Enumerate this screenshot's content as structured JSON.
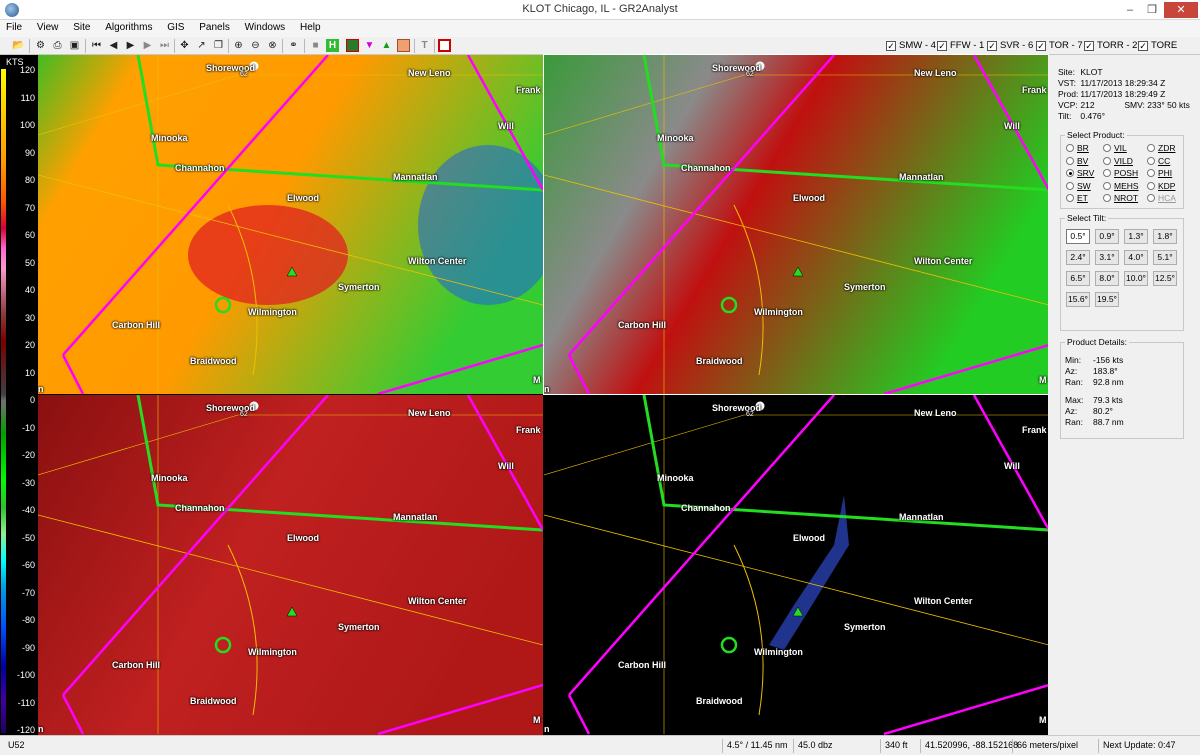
{
  "window": {
    "title": "KLOT Chicago, IL - GR2Analyst",
    "minimize": "–",
    "restore": "❒",
    "close": "✕"
  },
  "menu": [
    "File",
    "View",
    "Site",
    "Algorithms",
    "GIS",
    "Panels",
    "Windows",
    "Help"
  ],
  "warnings": [
    {
      "label": "SMW - 4",
      "checked": true
    },
    {
      "label": "FFW - 1",
      "checked": true
    },
    {
      "label": "SVR - 6",
      "checked": true
    },
    {
      "label": "TOR - 7",
      "checked": true
    },
    {
      "label": "TORR - 2",
      "checked": true
    },
    {
      "label": "TORE",
      "checked": true
    }
  ],
  "legend": {
    "units": "KTS",
    "ticks": [
      "120",
      "110",
      "100",
      "90",
      "80",
      "70",
      "60",
      "50",
      "40",
      "30",
      "20",
      "10",
      "0",
      "-10",
      "-20",
      "-30",
      "-40",
      "-50",
      "-60",
      "-70",
      "-80",
      "-90",
      "-100",
      "-110",
      "-120"
    ]
  },
  "towns": {
    "shorewood": "Shorewood",
    "new_lenox": "New Leno",
    "frankfort": "Frank",
    "will": "Will",
    "minooka": "Minooka",
    "channahon": "Channahon",
    "manhattan": "Mannatlan",
    "elwood": "Elwood",
    "wilton_center": "Wilton Center",
    "symerton": "Symerton",
    "wilmington": "Wilmington",
    "carbon_hill": "Carbon Hill",
    "braidwood": "Braidwood",
    "route": "62",
    "edge_n": "n",
    "edge_m": "M"
  },
  "site_info": {
    "site_label": "Site:",
    "site": "KLOT",
    "vst_label": "VST:",
    "vst": "11/17/2013  18:29:34 Z",
    "prod_label": "Prod:",
    "prod": "11/17/2013  18:29:49 Z",
    "vcp_label": "VCP:",
    "vcp": "212",
    "smv_label": "SMV:",
    "smv": "233° 50 kts",
    "tilt_label": "Tilt:",
    "tilt": "0.476°"
  },
  "select_product": {
    "title": "Select Product:",
    "options": [
      {
        "label": "BR",
        "selected": false,
        "disabled": false
      },
      {
        "label": "VIL",
        "selected": false,
        "disabled": false
      },
      {
        "label": "ZDR",
        "selected": false,
        "disabled": false
      },
      {
        "label": "BV",
        "selected": false,
        "disabled": false
      },
      {
        "label": "VILD",
        "selected": false,
        "disabled": false
      },
      {
        "label": "CC",
        "selected": false,
        "disabled": false
      },
      {
        "label": "SRV",
        "selected": true,
        "disabled": false
      },
      {
        "label": "POSH",
        "selected": false,
        "disabled": false
      },
      {
        "label": "PHI",
        "selected": false,
        "disabled": false
      },
      {
        "label": "SW",
        "selected": false,
        "disabled": false
      },
      {
        "label": "MEHS",
        "selected": false,
        "disabled": false
      },
      {
        "label": "KDP",
        "selected": false,
        "disabled": false
      },
      {
        "label": "ET",
        "selected": false,
        "disabled": false
      },
      {
        "label": "NROT",
        "selected": false,
        "disabled": false
      },
      {
        "label": "HCA",
        "selected": false,
        "disabled": true
      }
    ]
  },
  "select_tilt": {
    "title": "Select Tilt:",
    "tilts": [
      "0.5°",
      "0.9°",
      "1.3°",
      "1.8°",
      "2.4°",
      "3.1°",
      "4.0°",
      "5.1°",
      "6.5°",
      "8.0°",
      "10.0°",
      "12.5°",
      "15.6°",
      "19.5°"
    ],
    "selected": "0.5°"
  },
  "product_details": {
    "title": "Product Details:",
    "min_label": "Min:",
    "min": "-156 kts",
    "min_az_label": "Az:",
    "min_az": "183.8°",
    "min_ran_label": "Ran:",
    "min_ran": "92.8 nm",
    "max_label": "Max:",
    "max": "79.3 kts",
    "max_az_label": "Az:",
    "max_az": "80.2°",
    "max_ran_label": "Ran:",
    "max_ran": "88.7 nm"
  },
  "status": {
    "id": "U52",
    "beam": "4.5° / 11.45 nm",
    "value": "45.0 dbz",
    "height": "340 ft",
    "coords": "41.520996, -88.152168",
    "scale": "66 meters/pixel",
    "next_update": "Next Update: 0:47"
  },
  "colors": {
    "warning_magenta": "#ff00ff",
    "county_green": "#22dd22",
    "road": "#f0c000"
  }
}
